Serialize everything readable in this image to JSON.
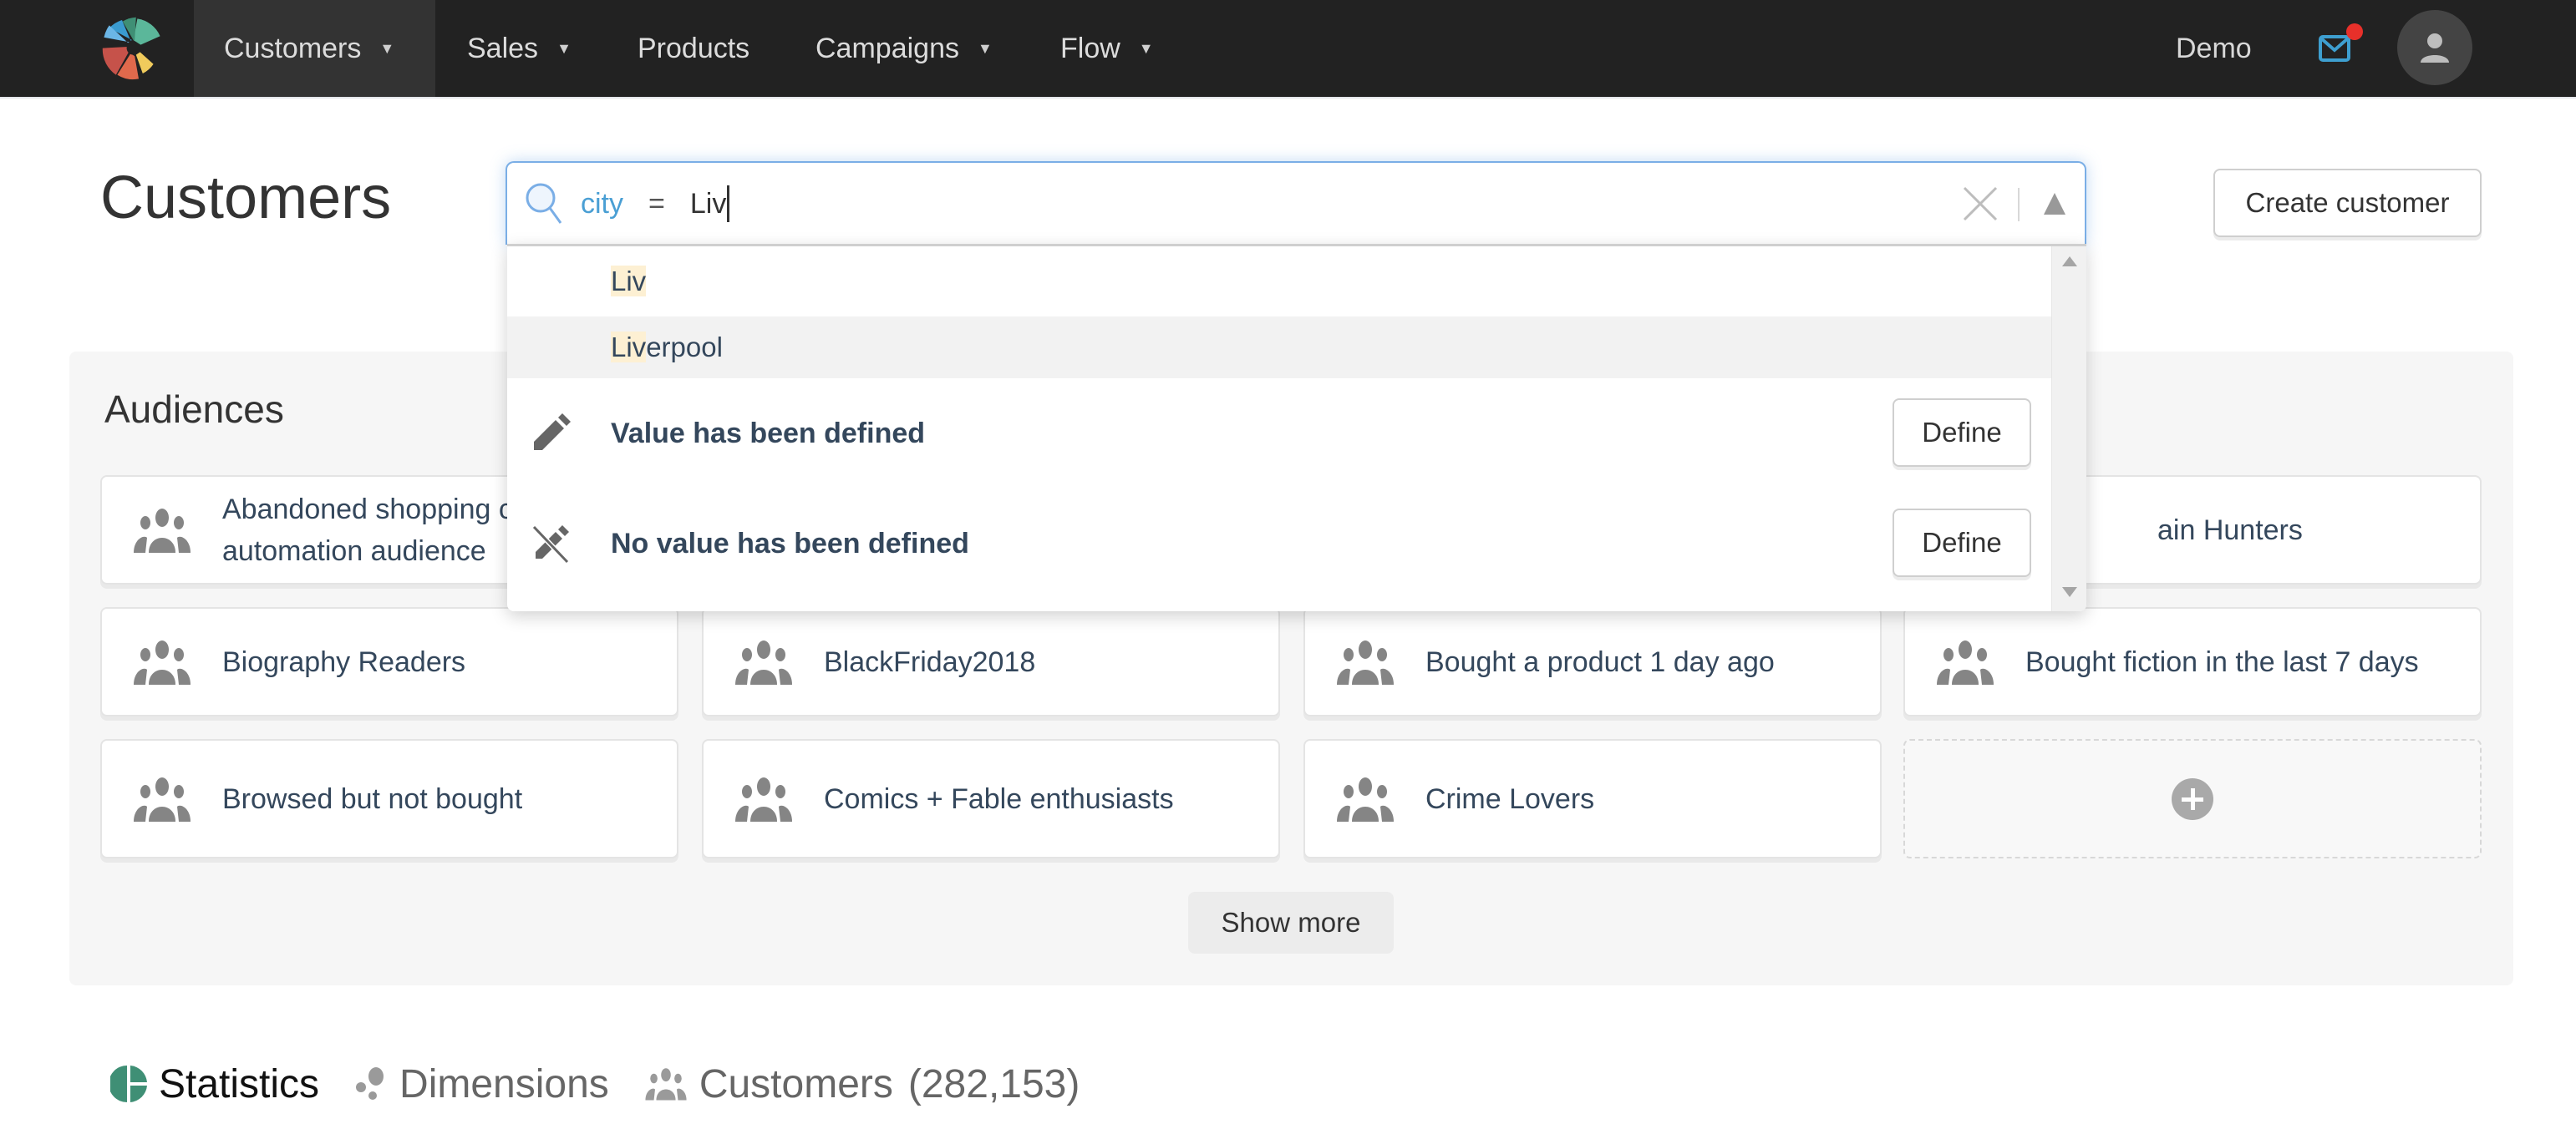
{
  "nav": {
    "items": [
      {
        "label": "Customers",
        "caret": "▼",
        "active": true
      },
      {
        "label": "Sales",
        "caret": "▼"
      },
      {
        "label": "Products"
      },
      {
        "label": "Campaigns",
        "caret": "▼"
      },
      {
        "label": "Flow",
        "caret": "▼"
      }
    ],
    "account_label": "Demo",
    "mail_icon": "mail-icon",
    "avatar_icon": "user-icon",
    "notification_color": "#e8302a",
    "mail_color": "#3e9fd0"
  },
  "header": {
    "title": "Customers",
    "create_button": "Create customer"
  },
  "search": {
    "icon": "search-icon",
    "field": "city",
    "operator": "=",
    "value": "Liv",
    "clear_icon": "close-icon",
    "toggle_icon": "triangle-up-icon",
    "suggestions": [
      {
        "match": "Liv",
        "rest": ""
      },
      {
        "match": "Liv",
        "rest": "erpool",
        "hovered": true
      }
    ],
    "options": [
      {
        "icon": "pencil-icon",
        "label": "Value has been defined",
        "button": "Define"
      },
      {
        "icon": "pencil-off-icon",
        "label": "No value has been defined",
        "button": "Define"
      }
    ]
  },
  "audiences": {
    "title": "Audiences",
    "cards": [
      {
        "label": "Abandoned shopping cart automation audience",
        "line1": "Abandoned shopping c",
        "line2": "automation audience"
      },
      {
        "label": "Bargain Hunters",
        "visible_text": "ain Hunters"
      },
      {
        "label": "Biography Readers"
      },
      {
        "label": "BlackFriday2018"
      },
      {
        "label": "Bought a product 1 day ago"
      },
      {
        "label": "Bought fiction in the last 7 days"
      },
      {
        "label": "Browsed but not bought"
      },
      {
        "label": "Comics + Fable enthusiasts"
      },
      {
        "label": "Crime Lovers"
      }
    ],
    "add_icon": "plus-circle-icon",
    "show_more": "Show more"
  },
  "tabs": [
    {
      "label": "Statistics",
      "icon": "pie-chart-icon",
      "active": true
    },
    {
      "label": "Dimensions",
      "icon": "bubbles-icon"
    },
    {
      "label": "Customers",
      "icon": "people-icon",
      "count": "(282,153)"
    }
  ],
  "colors": {
    "nav_bg": "#222222",
    "nav_active_bg": "#333333",
    "accent_blue": "#4a9fd4",
    "highlight": "#fdf0d3",
    "stats_green": "#3f8f75",
    "text_dark": "#34475c"
  }
}
